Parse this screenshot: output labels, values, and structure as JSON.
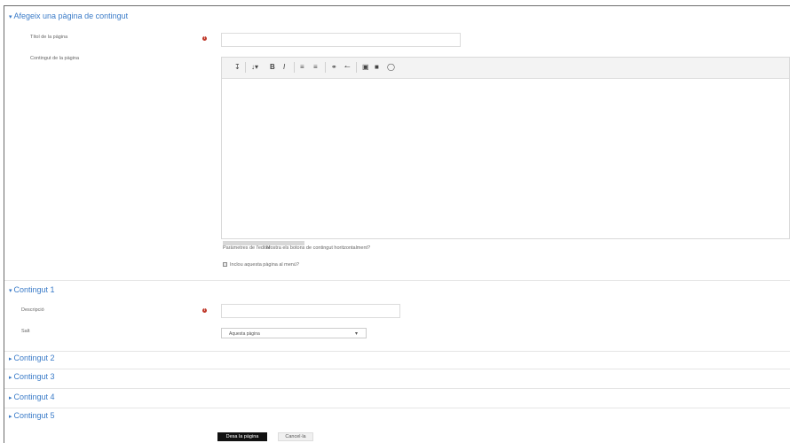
{
  "sections": {
    "main": "Afegeix una pàgina de contingut",
    "c1": "Contingut 1",
    "c2": "Contingut 2",
    "c3": "Contingut 3",
    "c4": "Contingut 4",
    "c5": "Contingut 5"
  },
  "fields": {
    "page_title_label": "Títol de la pàgina",
    "page_content_label": "Contingut de la pàgina",
    "description_label": "Descripció",
    "jump_label": "Salt",
    "jump_value": "Aquesta pàgina"
  },
  "editor": {
    "status_text": "Paràmetres de l'editor",
    "checkbox1_label": "Mostra els botons de contingut horitzontalment?",
    "checkbox2_label": "Inclou aquesta pàgina al menú?"
  },
  "buttons": {
    "save": "Desa la pàgina",
    "cancel": "Cancel·la"
  },
  "colors": {
    "accent": "#3a7bc8",
    "required": "#c0392b",
    "primary_button": "#111111"
  }
}
